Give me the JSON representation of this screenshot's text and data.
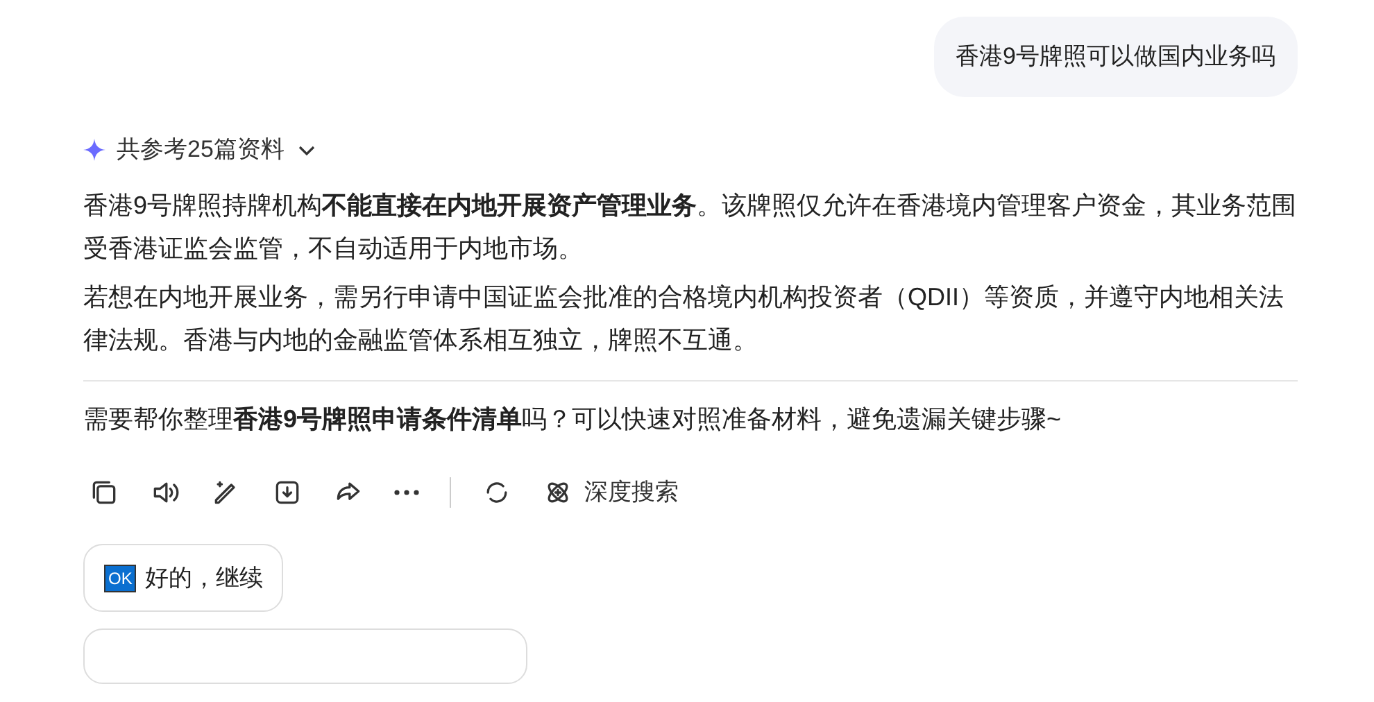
{
  "user_message": "香港9号牌照可以做国内业务吗",
  "sources": {
    "label": "共参考25篇资料",
    "expanded": false
  },
  "answer_paragraphs": [
    "香港9号牌照持牌机构**不能直接在内地开展资产管理业务**。该牌照仅允许在香港境内管理客户资金，其业务范围受香港证监会监管，不自动适用于内地市场。",
    "若想在内地开展业务，需另行申请中国证监会批准的合格境内机构投资者（QDII）等资质，并遵守内地相关法律法规。香港与内地的金融监管体系相互独立，牌照不互通。"
  ],
  "follow_up": "需要帮你整理**香港9号牌照申请条件清单**吗？可以快速对照准备材料，避免遗漏关键步骤~",
  "actions": [
    {
      "kind": "copy"
    },
    {
      "kind": "speak"
    },
    {
      "kind": "edit"
    },
    {
      "kind": "download"
    },
    {
      "kind": "share"
    },
    {
      "kind": "more"
    },
    {
      "kind": "divider"
    },
    {
      "kind": "regenerate"
    },
    {
      "kind": "deep_search",
      "label": "深度搜索"
    }
  ],
  "suggestions": [
    {
      "badge": "OK",
      "label": "好的，继续"
    },
    {
      "kind": "cut"
    }
  ]
}
